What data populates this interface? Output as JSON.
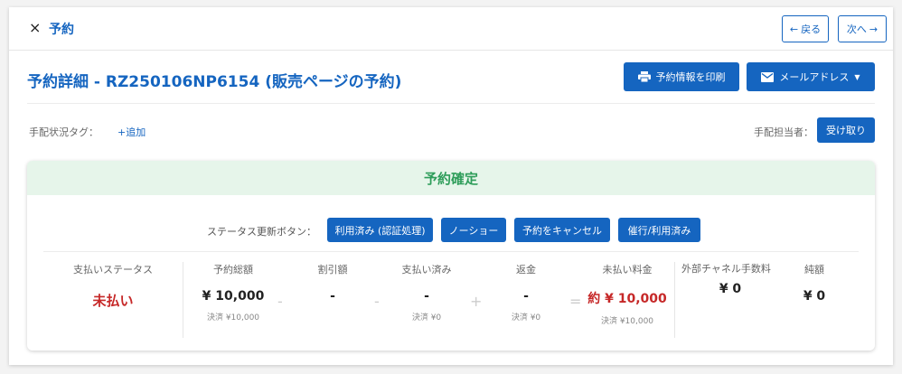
{
  "header": {
    "close_icon": "×",
    "title": "予約",
    "back_label": "戻る",
    "next_label": "次へ"
  },
  "page": {
    "title": "予約詳細 - RZ250106NP6154 (販売ページの予約)",
    "print_label": "予約情報を印刷",
    "email_label": "メールアドレス"
  },
  "tags": {
    "label": "手配状況タグ：",
    "add_label": "+追加",
    "assignee_label": "手配担当者：",
    "receive_label": "受け取り"
  },
  "reservation": {
    "banner": "予約確定",
    "status_buttons_label": "ステータス更新ボタン：",
    "status_buttons": [
      "利用済み (認証処理)",
      "ノーショー",
      "予約をキャンセル",
      "催行/利用済み"
    ]
  },
  "summary": {
    "payment_status": {
      "label": "支払いステータス",
      "value": "未払い"
    },
    "total": {
      "label": "予約総額",
      "value": "¥ 10,000",
      "sub": "決済 ¥10,000"
    },
    "discount": {
      "label": "割引額",
      "value": "-"
    },
    "paid": {
      "label": "支払い済み",
      "value": "-",
      "sub": "決済 ¥0"
    },
    "refund": {
      "label": "返金",
      "value": "-",
      "sub": "決済 ¥0"
    },
    "unpaid": {
      "label": "未払い料金",
      "value": "約 ¥ 10,000",
      "sub": "決済 ¥10,000"
    },
    "channel_fee": {
      "label": "外部チャネル手数料",
      "value": "¥ 0"
    },
    "net": {
      "label": "純額",
      "value": "¥ 0"
    },
    "operators": {
      "minus1": "-",
      "minus2": "-",
      "plus": "+",
      "equals": "="
    }
  },
  "colors": {
    "primary": "#1565c0",
    "success": "#2e9d5a",
    "success_bg": "#e6f5ea",
    "danger": "#c62828"
  }
}
